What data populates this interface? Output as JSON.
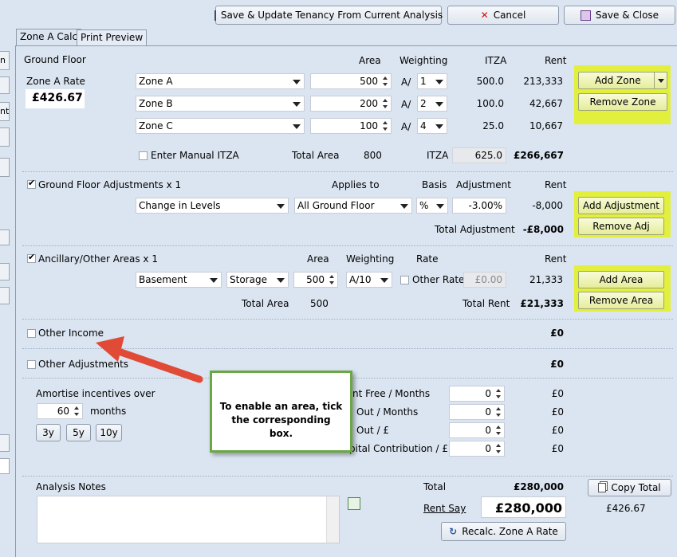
{
  "toolbar": {
    "save_update": "Save & Update Tenancy From Current Analysis",
    "cancel": "Cancel",
    "save_close": "Save & Close"
  },
  "tabs": [
    "Zone A Calc",
    "Print Preview"
  ],
  "ground_floor": {
    "title": "Ground Floor",
    "zone_a_rate_label": "Zone A Rate",
    "zone_a_rate": "£426.67",
    "col_area": "Area",
    "col_weighting": "Weighting",
    "col_itza": "ITZA",
    "col_rent": "Rent",
    "zones": [
      {
        "name": "Zone A",
        "area": "500",
        "a": "A/",
        "w": "1",
        "itza": "500.0",
        "rent": "213,333"
      },
      {
        "name": "Zone B",
        "area": "200",
        "a": "A/",
        "w": "2",
        "itza": "100.0",
        "rent": "42,667"
      },
      {
        "name": "Zone C",
        "area": "100",
        "a": "A/",
        "w": "4",
        "itza": "25.0",
        "rent": "10,667"
      }
    ],
    "manual_itza": "Enter Manual ITZA",
    "total_area_label": "Total Area",
    "total_area": "800",
    "itza_label": "ITZA",
    "itza_total": "625.0",
    "rent_total": "£266,667",
    "add_zone": "Add Zone",
    "remove_zone": "Remove Zone"
  },
  "adjustments": {
    "title": "Ground Floor Adjustments x 1",
    "applies_to_label": "Applies to",
    "basis_label": "Basis",
    "adjustment_label": "Adjustment",
    "rent_label": "Rent",
    "type": "Change in Levels",
    "applies_to": "All Ground Floor",
    "basis": "%",
    "adjustment": "-3.00%",
    "rent": "-8,000",
    "total_label": "Total Adjustment",
    "total": "-£8,000",
    "add": "Add Adjustment",
    "remove": "Remove Adj"
  },
  "ancillary": {
    "title": "Ancillary/Other Areas x 1",
    "area_label": "Area",
    "weighting_label": "Weighting",
    "rate_label": "Rate",
    "rent_label": "Rent",
    "floor": "Basement",
    "use": "Storage",
    "area": "500",
    "weighting": "A/10",
    "other_rate_label": "Other Rate",
    "other_rate": "£0.00",
    "rent": "21,333",
    "total_area_label": "Total Area",
    "total_area": "500",
    "total_rent_label": "Total Rent",
    "total_rent": "£21,333",
    "add": "Add Area",
    "remove": "Remove Area"
  },
  "other_income": {
    "label": "Other Income",
    "value": "£0"
  },
  "other_adjustments": {
    "label": "Other Adjustments",
    "value": "£0"
  },
  "amortise": {
    "label": "Amortise incentives over",
    "months_value": "60",
    "months_label": "months",
    "buttons": [
      "3y",
      "5y",
      "10y"
    ]
  },
  "incentives": [
    {
      "label": "nt Free / Months",
      "value": "0",
      "amount": "£0"
    },
    {
      "label": "Out / Months",
      "value": "0",
      "amount": "£0"
    },
    {
      "label": "Out / £",
      "value": "0",
      "amount": "£0"
    },
    {
      "label": "pital Contribution / £",
      "value": "0",
      "amount": "£0"
    }
  ],
  "callout": "To enable an area, tick the corresponding box.",
  "notes": {
    "label": "Analysis Notes"
  },
  "totals": {
    "total_label": "Total",
    "total": "£280,000",
    "rent_say_label": "Rent Say",
    "rent_say": "£280,000",
    "copy_total": "Copy Total",
    "rate": "£426.67",
    "recalc": "Recalc. Zone A Rate"
  },
  "left_stubs": [
    "n",
    "nt"
  ]
}
